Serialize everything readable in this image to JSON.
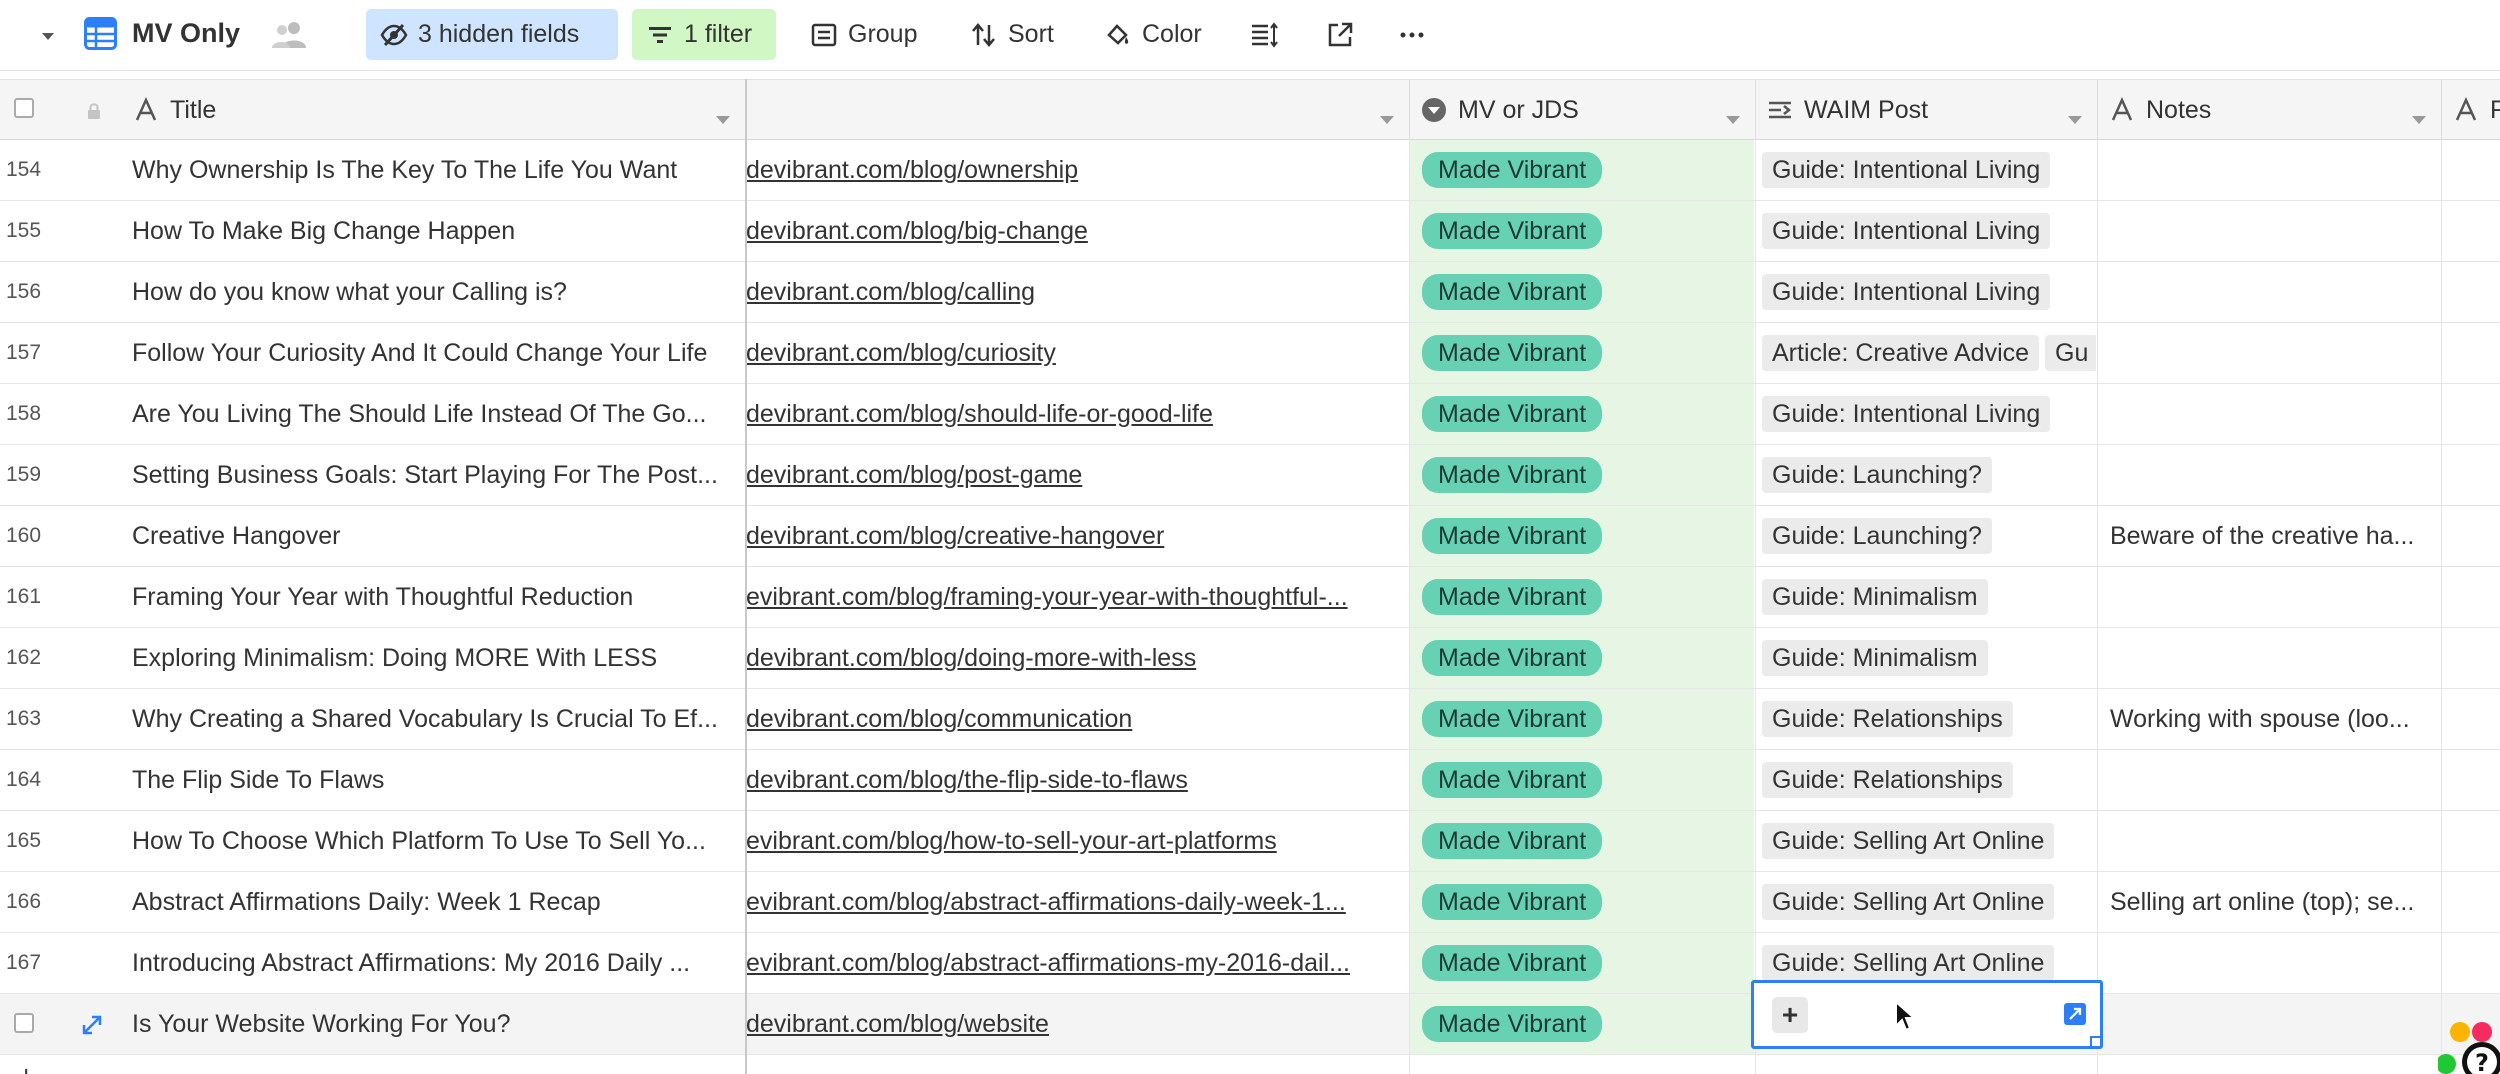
{
  "toolbar": {
    "view_name": "MV Only",
    "hidden_fields_label": "3 hidden fields",
    "filter_label": "1 filter",
    "group_label": "Group",
    "sort_label": "Sort",
    "color_label": "Color",
    "colors": {
      "hidden_bg": "#cfe5ff",
      "filter_bg": "#d1f7c4",
      "view_icon": "#2d7ff9"
    }
  },
  "columns": {
    "title": "Title",
    "url": "",
    "mv_or_jds": "MV or JDS",
    "waim_post": "WAIM Post",
    "notes": "Notes",
    "next_partial": "F"
  },
  "rows": [
    {
      "num": "154",
      "title": "Why Ownership Is The Key To The Life You Want",
      "url": "devibrant.com/blog/ownership",
      "mv": "Made Vibrant",
      "waim": [
        "Guide: Intentional Living"
      ],
      "notes": ""
    },
    {
      "num": "155",
      "title": "How To Make Big Change Happen",
      "url": "devibrant.com/blog/big-change",
      "mv": "Made Vibrant",
      "waim": [
        "Guide: Intentional Living"
      ],
      "notes": ""
    },
    {
      "num": "156",
      "title": "How do you know what your Calling is?",
      "url": "devibrant.com/blog/calling",
      "mv": "Made Vibrant",
      "waim": [
        "Guide: Intentional Living"
      ],
      "notes": ""
    },
    {
      "num": "157",
      "title": "Follow Your Curiosity And It Could Change Your Life",
      "url": "devibrant.com/blog/curiosity",
      "mv": "Made Vibrant",
      "waim": [
        "Article: Creative Advice",
        "Gu"
      ],
      "notes": ""
    },
    {
      "num": "158",
      "title": "Are You Living The Should Life Instead Of The Go...",
      "url": "devibrant.com/blog/should-life-or-good-life",
      "mv": "Made Vibrant",
      "waim": [
        "Guide: Intentional Living"
      ],
      "notes": ""
    },
    {
      "num": "159",
      "title": "Setting Business Goals: Start Playing For The Post...",
      "url": "devibrant.com/blog/post-game",
      "mv": "Made Vibrant",
      "waim": [
        "Guide: Launching?"
      ],
      "notes": ""
    },
    {
      "num": "160",
      "title": "Creative Hangover",
      "url": "devibrant.com/blog/creative-hangover",
      "mv": "Made Vibrant",
      "waim": [
        "Guide: Launching?"
      ],
      "notes": "Beware of the creative ha..."
    },
    {
      "num": "161",
      "title": "Framing Your Year with Thoughtful Reduction",
      "url": "evibrant.com/blog/framing-your-year-with-thoughtful-...",
      "mv": "Made Vibrant",
      "waim": [
        "Guide: Minimalism"
      ],
      "notes": ""
    },
    {
      "num": "162",
      "title": "Exploring Minimalism: Doing MORE With LESS",
      "url": "devibrant.com/blog/doing-more-with-less",
      "mv": "Made Vibrant",
      "waim": [
        "Guide: Minimalism"
      ],
      "notes": ""
    },
    {
      "num": "163",
      "title": "Why Creating a Shared Vocabulary Is Crucial To Ef...",
      "url": "devibrant.com/blog/communication",
      "mv": "Made Vibrant",
      "waim": [
        "Guide: Relationships"
      ],
      "notes": "Working with spouse (loo..."
    },
    {
      "num": "164",
      "title": "The Flip Side To Flaws",
      "url": "devibrant.com/blog/the-flip-side-to-flaws",
      "mv": "Made Vibrant",
      "waim": [
        "Guide: Relationships"
      ],
      "notes": ""
    },
    {
      "num": "165",
      "title": "How To Choose Which Platform To Use To Sell Yo...",
      "url": "evibrant.com/blog/how-to-sell-your-art-platforms",
      "mv": "Made Vibrant",
      "waim": [
        "Guide: Selling Art Online"
      ],
      "notes": ""
    },
    {
      "num": "166",
      "title": "Abstract Affirmations Daily: Week 1 Recap",
      "url": "evibrant.com/blog/abstract-affirmations-daily-week-1...",
      "mv": "Made Vibrant",
      "waim": [
        "Guide: Selling Art Online"
      ],
      "notes": "Selling art online (top); se..."
    },
    {
      "num": "167",
      "title": "Introducing Abstract Affirmations: My 2016 Daily ...",
      "url": "evibrant.com/blog/abstract-affirmations-my-2016-dail...",
      "mv": "Made Vibrant",
      "waim": [
        "Guide: Selling Art Online"
      ],
      "notes": ""
    },
    {
      "num": "",
      "title": "Is Your Website Working For You?",
      "url": "devibrant.com/blog/website",
      "mv": "Made Vibrant",
      "waim": [],
      "notes": ""
    }
  ],
  "add_row_label": "+",
  "active_cell": {
    "plus_label": "+"
  }
}
